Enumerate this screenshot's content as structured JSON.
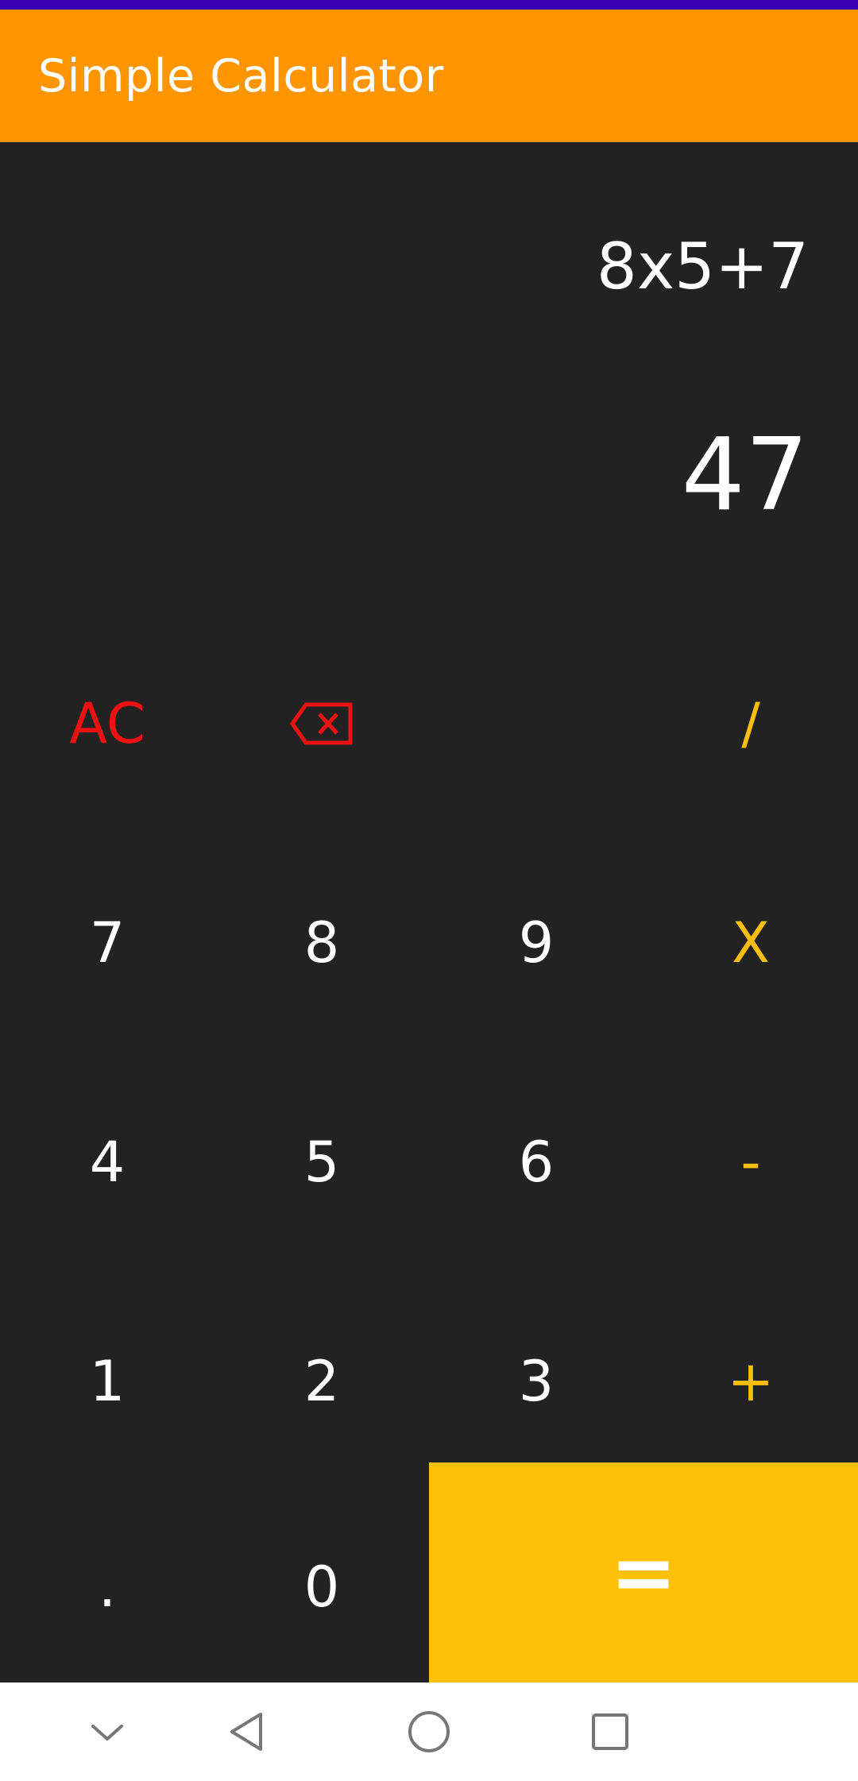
{
  "app": {
    "title": "Simple Calculator"
  },
  "display": {
    "expression": "8x5+7",
    "result": "47"
  },
  "keys": {
    "ac": "AC",
    "divide": "/",
    "seven": "7",
    "eight": "8",
    "nine": "9",
    "multiply": "X",
    "four": "4",
    "five": "5",
    "six": "6",
    "minus": "-",
    "one": "1",
    "two": "2",
    "three": "3",
    "plus": "+",
    "dot": ".",
    "zero": "0",
    "equals": "="
  },
  "icons": {
    "backspace": "backspace-icon"
  },
  "colors": {
    "app_bar": "#ff9500",
    "status_bar": "#3a00b5",
    "background": "#222222",
    "red_keys": "#ee1111",
    "operator_keys": "#f9bd0c",
    "equals_bg": "#ffc107"
  },
  "navigation": {
    "buttons": [
      "collapse-icon",
      "back-icon",
      "home-icon",
      "recents-icon"
    ]
  }
}
